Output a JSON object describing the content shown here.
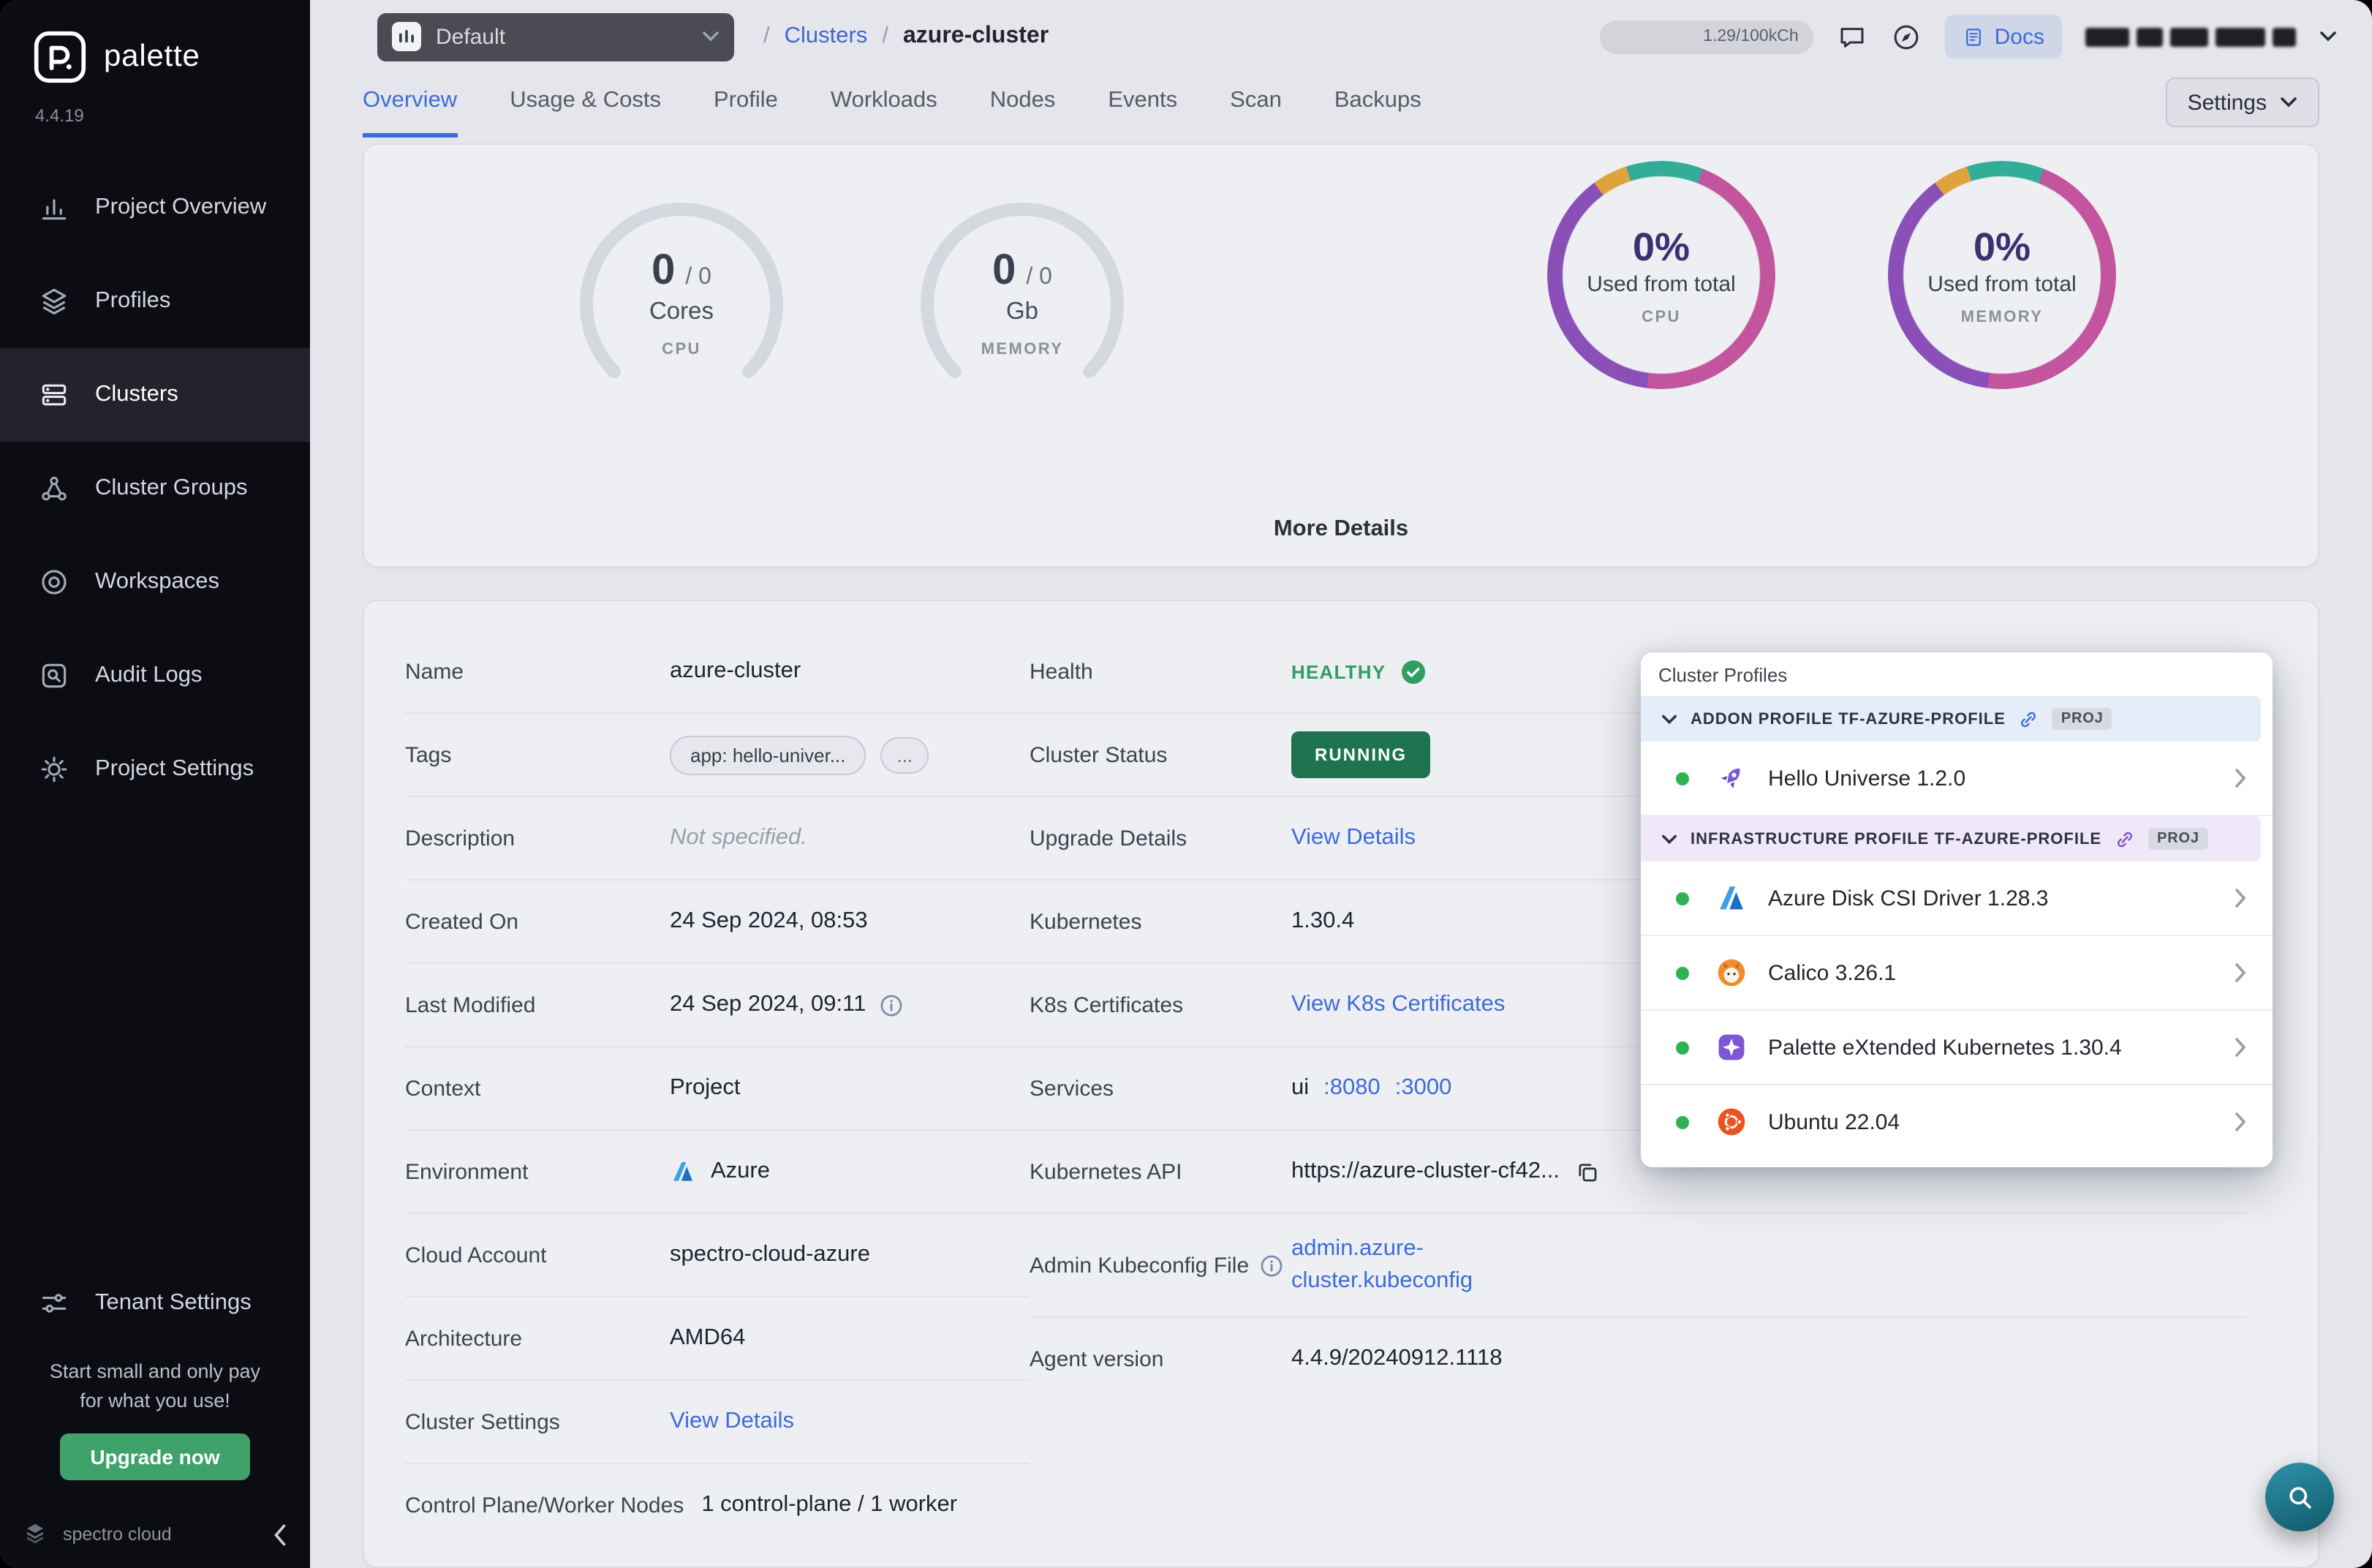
{
  "colors": {
    "accent_blue": "#3d6bd8",
    "healthy_green": "#2f9e63",
    "running_bg": "#1e7350",
    "upgrade_green": "#3ea26a",
    "fab_teal": "#1d7a8e",
    "donut_magenta": "#c2559e",
    "donut_purple": "#8a50b8",
    "donut_teal": "#31ad98",
    "donut_orange": "#e0a23c"
  },
  "sidebar": {
    "brand": "palette",
    "version": "4.4.19",
    "items": [
      "Project Overview",
      "Profiles",
      "Clusters",
      "Cluster Groups",
      "Workspaces",
      "Audit Logs",
      "Project Settings"
    ],
    "active_item": "Clusters",
    "tenant_settings": "Tenant Settings",
    "promo_line1": "Start small and only pay",
    "promo_line2": "for what you use!",
    "upgrade_button": "Upgrade now",
    "footer_brand": "spectro cloud"
  },
  "header": {
    "project_selector": "Default",
    "breadcrumb_sep": "/",
    "breadcrumb_section": "Clusters",
    "breadcrumb_current": "azure-cluster",
    "usage_meter": "1.29/100kCh",
    "docs_button": "Docs"
  },
  "tabs": {
    "items": [
      "Overview",
      "Usage & Costs",
      "Profile",
      "Workloads",
      "Nodes",
      "Events",
      "Scan",
      "Backups"
    ],
    "active": "Overview",
    "settings_button": "Settings"
  },
  "metrics": {
    "cpu_gauge": {
      "value": "0",
      "total": "/ 0",
      "unit": "Cores",
      "label": "CPU"
    },
    "memory_gauge": {
      "value": "0",
      "total": "/ 0",
      "unit": "Gb",
      "label": "MEMORY"
    },
    "cpu_donut": {
      "percent": "0%",
      "caption": "Used from total",
      "label": "CPU"
    },
    "memory_donut": {
      "percent": "0%",
      "caption": "Used from total",
      "label": "MEMORY"
    },
    "more_details": "More Details"
  },
  "overview": {
    "name": {
      "label": "Name",
      "value": "azure-cluster"
    },
    "tags": {
      "label": "Tags",
      "chip": "app: hello-univer...",
      "more": "..."
    },
    "description": {
      "label": "Description",
      "value": "Not specified."
    },
    "created_on": {
      "label": "Created On",
      "value": "24 Sep 2024, 08:53"
    },
    "last_modified": {
      "label": "Last Modified",
      "value": "24 Sep 2024, 09:11"
    },
    "context": {
      "label": "Context",
      "value": "Project"
    },
    "environment": {
      "label": "Environment",
      "value": "Azure"
    },
    "cloud_account": {
      "label": "Cloud Account",
      "value": "spectro-cloud-azure"
    },
    "architecture": {
      "label": "Architecture",
      "value": "AMD64"
    },
    "cluster_settings": {
      "label": "Cluster Settings",
      "link": "View Details"
    },
    "nodes": {
      "label": "Control Plane/Worker Nodes",
      "value": "1 control-plane / 1 worker"
    },
    "health": {
      "label": "Health",
      "value": "HEALTHY"
    },
    "cluster_status": {
      "label": "Cluster Status",
      "value": "RUNNING"
    },
    "upgrade_details": {
      "label": "Upgrade Details",
      "link": "View Details"
    },
    "kubernetes": {
      "label": "Kubernetes",
      "value": "1.30.4"
    },
    "k8s_certificates": {
      "label": "K8s Certificates",
      "link": "View K8s Certificates"
    },
    "services": {
      "label": "Services",
      "name": "ui",
      "port1": ":8080",
      "port2": ":3000"
    },
    "kubernetes_api": {
      "label": "Kubernetes API",
      "value": "https://azure-cluster-cf42..."
    },
    "kubeconfig": {
      "label": "Admin Kubeconfig File",
      "line1": "admin.azure-",
      "line2": "cluster.kubeconfig"
    },
    "agent_version": {
      "label": "Agent version",
      "value": "4.4.9/20240912.1118"
    }
  },
  "cluster_profiles": {
    "title": "Cluster Profiles",
    "addon_header": "ADDON PROFILE TF-AZURE-PROFILE",
    "addon_badge": "PROJ",
    "infra_header": "INFRASTRUCTURE PROFILE TF-AZURE-PROFILE",
    "infra_badge": "PROJ",
    "profiles": [
      "Hello Universe 1.2.0",
      "Azure Disk CSI Driver 1.28.3",
      "Calico 3.26.1",
      "Palette eXtended Kubernetes 1.30.4",
      "Ubuntu 22.04"
    ]
  }
}
